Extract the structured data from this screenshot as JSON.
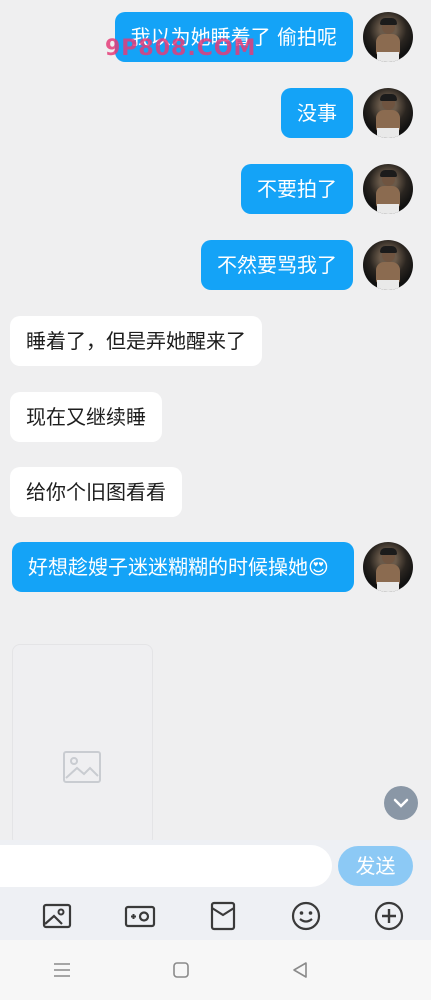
{
  "messages": [
    {
      "side": "out",
      "text": "我以为她睡着了  偷拍呢"
    },
    {
      "side": "out",
      "text": "没事"
    },
    {
      "side": "out",
      "text": "不要拍了"
    },
    {
      "side": "out",
      "text": "不然要骂我了"
    },
    {
      "side": "in",
      "text": "睡着了，但是弄她醒来了"
    },
    {
      "side": "in",
      "text": "现在又继续睡"
    },
    {
      "side": "in",
      "text": "给你个旧图看看"
    },
    {
      "side": "out",
      "text": "好想趁嫂子迷迷糊糊的时候操她😍"
    }
  ],
  "watermark": "9P808.COM",
  "composer": {
    "placeholder": "",
    "send_label": "发送"
  },
  "toolbar_icons": [
    "image-icon",
    "camera-icon",
    "red-packet-icon",
    "emoji-icon",
    "plus-icon"
  ],
  "nav_icons": [
    "menu-icon",
    "home-icon",
    "back-icon"
  ],
  "colors": {
    "outgoing": "#14a3f7",
    "incoming": "#ffffff",
    "send": "#8cc9f5",
    "background": "#efeff0"
  }
}
